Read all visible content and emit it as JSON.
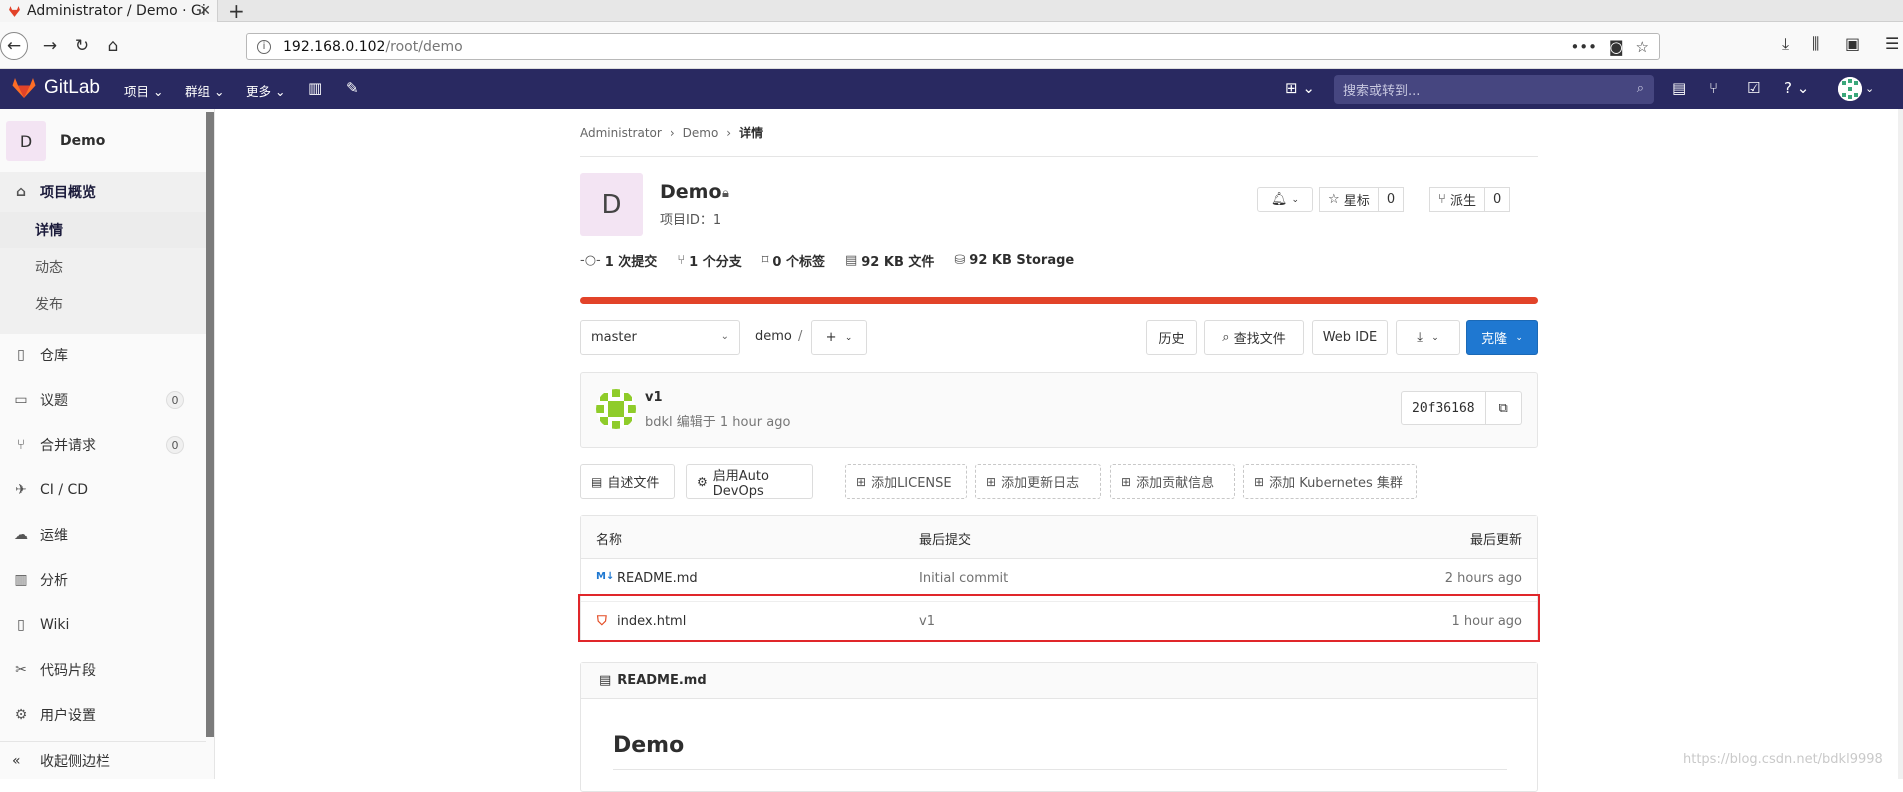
{
  "browser": {
    "tab_title": "Administrator / Demo · Gi",
    "url_host": "192.168.0.102",
    "url_path": "/root/demo"
  },
  "header": {
    "brand": "GitLab",
    "menu": [
      "项目",
      "群组",
      "更多"
    ],
    "search_placeholder": "搜索或转到..."
  },
  "sidebar": {
    "project_initial": "D",
    "project_name": "Demo",
    "overview": "项目概览",
    "sub": [
      "详情",
      "动态",
      "发布"
    ],
    "items": [
      {
        "label": "仓库"
      },
      {
        "label": "议题",
        "badge": "0"
      },
      {
        "label": "合并请求",
        "badge": "0"
      },
      {
        "label": "CI / CD"
      },
      {
        "label": "运维"
      },
      {
        "label": "分析"
      },
      {
        "label": "Wiki"
      },
      {
        "label": "代码片段"
      },
      {
        "label": "用户设置"
      }
    ],
    "collapse": "收起侧边栏"
  },
  "breadcrumb": {
    "items": [
      "Administrator",
      "Demo",
      "详情"
    ]
  },
  "project": {
    "initial": "D",
    "name": "Demo",
    "id_label": "项目ID：1",
    "star_label": "星标",
    "star_count": "0",
    "fork_label": "派生",
    "fork_count": "0"
  },
  "stats": {
    "commits": "1 次提交",
    "branches": "1 个分支",
    "tags": "0 个标签",
    "files": "92 KB 文件",
    "storage": "92 KB Storage"
  },
  "repo_bar": {
    "branch": "master",
    "path_root": "demo",
    "path_sep": "/",
    "history": "历史",
    "find_file": "查找文件",
    "web_ide": "Web IDE",
    "clone": "克隆"
  },
  "commit": {
    "title": "v1",
    "meta": "bdkl 编辑于 1 hour ago",
    "sha": "20f36168"
  },
  "quick_actions": [
    "自述文件",
    "启用Auto DevOps",
    "添加LICENSE",
    "添加更新日志",
    "添加贡献信息",
    "添加 Kubernetes 集群"
  ],
  "files_table": {
    "headers": [
      "名称",
      "最后提交",
      "最后更新"
    ],
    "rows": [
      {
        "name": "README.md",
        "commit": "Initial commit",
        "updated": "2 hours ago"
      },
      {
        "name": "index.html",
        "commit": "v1",
        "updated": "1 hour ago"
      }
    ]
  },
  "readme": {
    "filename": "README.md",
    "heading": "Demo"
  },
  "watermark": "https://blog.csdn.net/bdkl9998",
  "colors": {
    "header_bg": "#292961",
    "progress": "#e24329",
    "clone_blue": "#1f78d1",
    "highlight": "#e0262a"
  }
}
